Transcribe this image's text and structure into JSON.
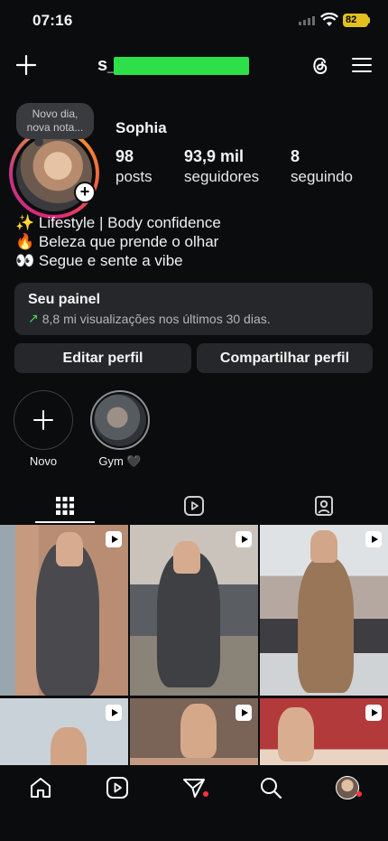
{
  "status_bar": {
    "time": "07:16",
    "battery": "82"
  },
  "header": {
    "username": "s____ldo"
  },
  "note": {
    "text_line1": "Novo dia,",
    "text_line2": "nova nota..."
  },
  "profile": {
    "name": "Sophia",
    "stats": [
      {
        "num": "98",
        "label": "posts"
      },
      {
        "num": "93,9 mil",
        "label": "seguidores"
      },
      {
        "num": "8",
        "label": "seguindo"
      }
    ],
    "bio": [
      "✨ Lifestyle | Body confidence",
      "🔥 Beleza que prende o olhar",
      "👀 Segue e sente a vibe"
    ]
  },
  "dashboard": {
    "title": "Seu painel",
    "arrow": "↗",
    "subtitle": "8,8 mi visualizações nos últimos 30 dias."
  },
  "buttons": {
    "edit": "Editar perfil",
    "share": "Compartilhar perfil"
  },
  "highlights": [
    {
      "label": "Novo",
      "icon": "plus-icon"
    },
    {
      "label": "Gym 🖤",
      "icon": "story-thumbnail"
    }
  ],
  "tabs": [
    "grid-icon",
    "reels-icon",
    "tagged-icon"
  ],
  "nav": [
    "home-icon",
    "reels-icon",
    "direct-icon",
    "search-icon",
    "profile-avatar"
  ],
  "colors": {
    "accent_red": "#ff3040",
    "battery": "#e3c020",
    "panel": "#26272b",
    "background": "#0b0c0e"
  }
}
